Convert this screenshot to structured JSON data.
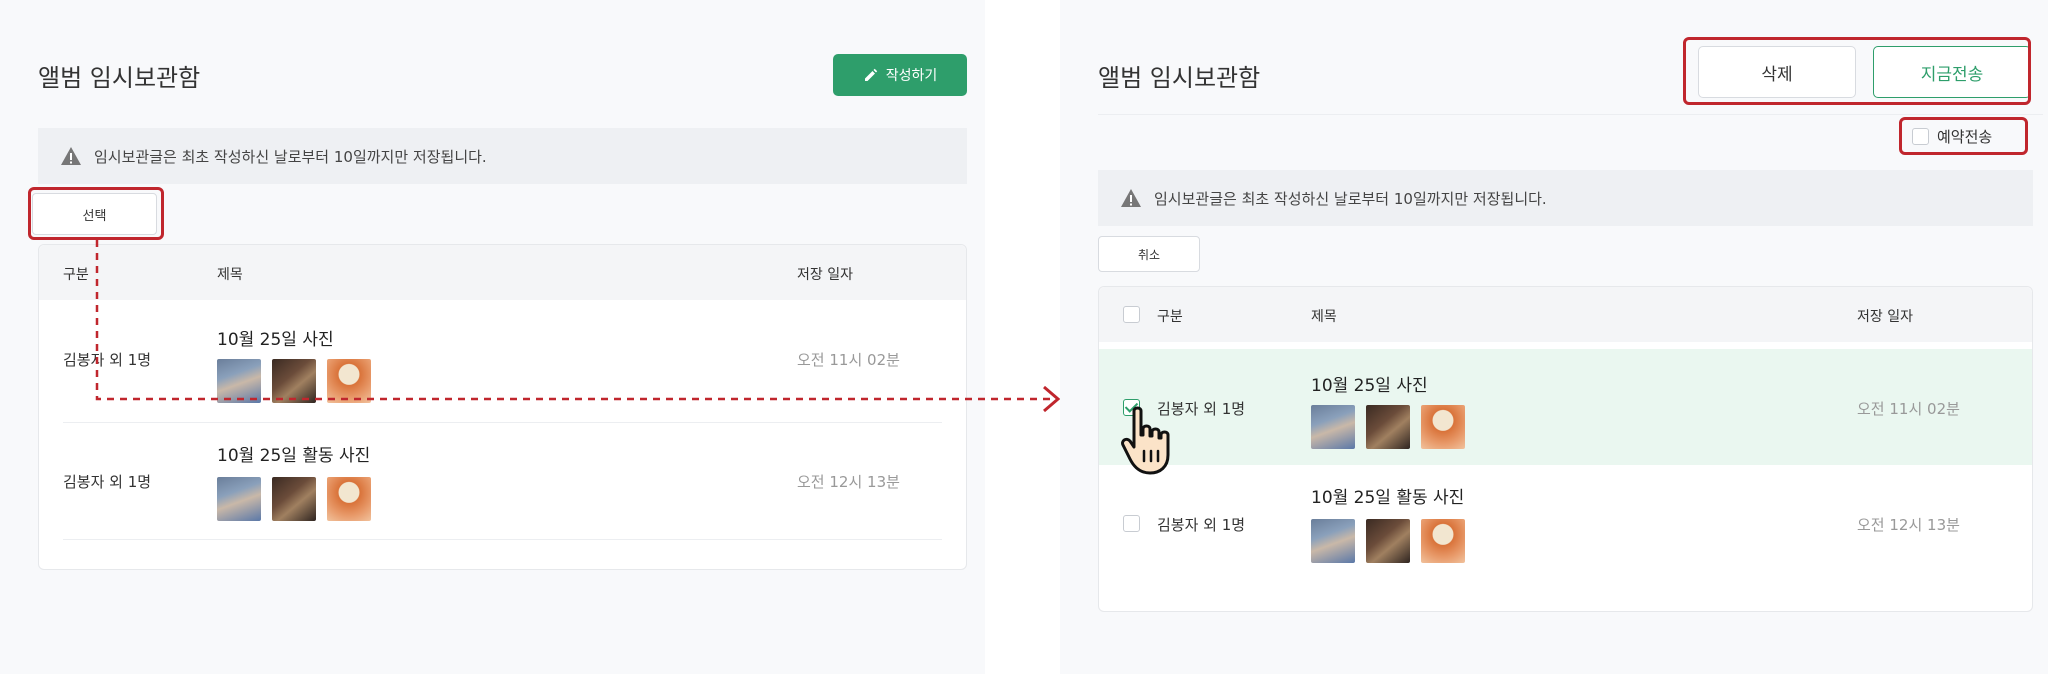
{
  "left": {
    "title": "앨범 임시보관함",
    "write_button": "작성하기",
    "notice": "임시보관글은 최초 작성하신 날로부터 10일까지만 저장됩니다.",
    "select_button": "선택",
    "table": {
      "headers": [
        "구분",
        "제목",
        "저장 일자"
      ],
      "rows": [
        {
          "category": "김봉자 외 1명",
          "title": "10월 25일 사진",
          "date": "오전 11시 02분"
        },
        {
          "category": "김봉자 외 1명",
          "title": "10월 25일 활동 사진",
          "date": "오전 12시 13분"
        }
      ]
    }
  },
  "right": {
    "title": "앨범 임시보관함",
    "delete_button": "삭제",
    "send_now_button": "지금전송",
    "reserve_send_label": "예약전송",
    "notice": "임시보관글은 최초 작성하신 날로부터 10일까지만 저장됩니다.",
    "cancel_button": "취소",
    "table": {
      "headers": [
        "구분",
        "제목",
        "저장 일자"
      ],
      "rows": [
        {
          "category": "김봉자 외 1명",
          "title": "10월 25일 사진",
          "date": "오전 11시 02분",
          "checked": true
        },
        {
          "category": "김봉자 외 1명",
          "title": "10월 25일 활동 사진",
          "date": "오전 12시 13분",
          "checked": false
        }
      ]
    }
  },
  "colors": {
    "accent": "#2e9e6b",
    "highlight": "#c0262d",
    "selected_row": "#eaf7f0"
  },
  "icons": [
    "pencil-icon",
    "warning-icon",
    "checkbox-icon",
    "hand-pointer-icon",
    "arrow-right-icon"
  ]
}
